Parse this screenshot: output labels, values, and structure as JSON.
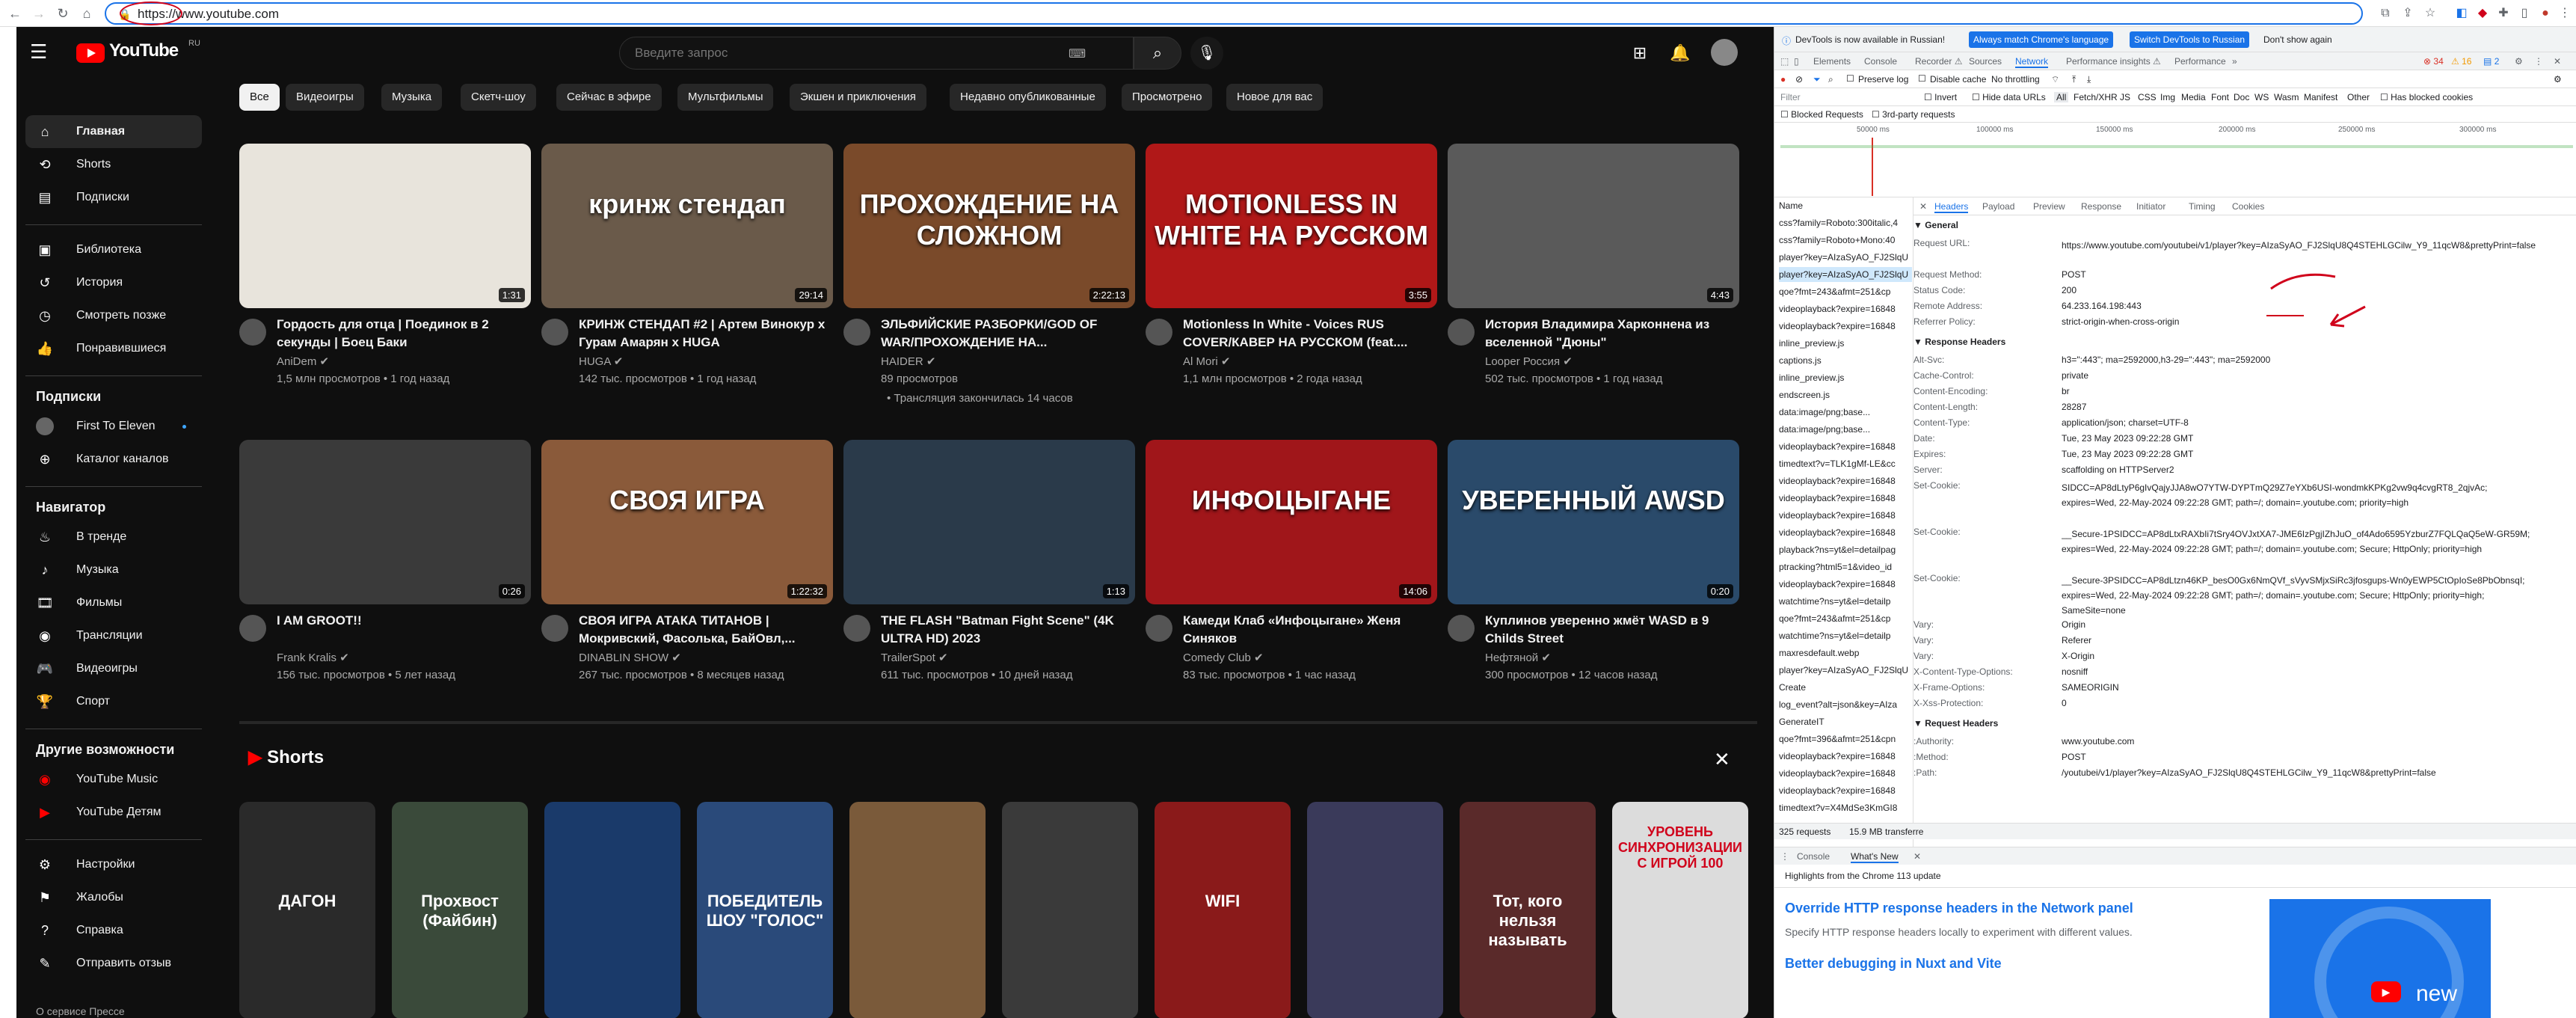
{
  "browser": {
    "url": "https://www.youtube.com",
    "icons": [
      "back-icon",
      "forward-icon",
      "reload-icon",
      "home-icon"
    ]
  },
  "youtube": {
    "logo_text": "YouTube",
    "country_code": "RU",
    "search_placeholder": "Введите запрос",
    "sidebar": {
      "main": [
        {
          "label": "Главная",
          "icon": "home-icon"
        },
        {
          "label": "Shorts",
          "icon": "shorts-icon"
        },
        {
          "label": "Подписки",
          "icon": "subscriptions-icon"
        }
      ],
      "library": [
        {
          "label": "Библиотека",
          "icon": "library-icon"
        },
        {
          "label": "История",
          "icon": "history-icon"
        },
        {
          "label": "Смотреть позже",
          "icon": "clock-icon"
        },
        {
          "label": "Понравившиеся",
          "icon": "like-icon"
        }
      ],
      "subs_title": "Подписки",
      "subs": [
        {
          "label": "First To Eleven"
        },
        {
          "label": "Каталог каналов"
        }
      ],
      "nav_title": "Навигатор",
      "nav": [
        {
          "label": "В тренде"
        },
        {
          "label": "Музыка"
        },
        {
          "label": "Фильмы"
        },
        {
          "label": "Трансляции"
        },
        {
          "label": "Видеоигры"
        },
        {
          "label": "Спорт"
        }
      ],
      "more_title": "Другие возможности",
      "more": [
        {
          "label": "YouTube Music"
        },
        {
          "label": "YouTube Детям"
        }
      ],
      "footer": [
        {
          "label": "Настройки"
        },
        {
          "label": "Жалобы"
        },
        {
          "label": "Справка"
        },
        {
          "label": "Отправить отзыв"
        }
      ],
      "bottom_text": "О сервисе  Прессе"
    },
    "chips": [
      "Все",
      "Видеоигры",
      "Музыка",
      "Скетч-шоу",
      "Сейчас в эфире",
      "Мультфильмы",
      "Экшен и приключения",
      "Недавно опубликованные",
      "Просмотрено",
      "Новое для вас"
    ],
    "videos": [
      {
        "title": "Гордость для отца | Поединок в 2 секунды | Боец Баки",
        "channel": "AniDem",
        "meta": "1,5 млн просмотров • 1 год назад",
        "duration": "1:31",
        "thumb_text": "",
        "color": "#e8e4dc"
      },
      {
        "title": "КРИНЖ СТЕНДАП #2 | Артем Винокур x Гурам Амарян x HUGA",
        "channel": "HUGA",
        "meta": "142 тыс. просмотров • 1 год назад",
        "duration": "29:14",
        "thumb_text": "кринж стендап",
        "color": "#6a5a4a"
      },
      {
        "title": "ЭЛЬФИЙСКИЕ РАЗБОРКИ/GOD OF WAR/ПРОХОЖДЕНИЕ НА...",
        "channel": "HAIDER",
        "meta": "89 просмотров",
        "extra": "• Трансляция закончилась 14 часов",
        "duration": "2:22:13",
        "thumb_text": "ПРОХОЖДЕНИЕ НА СЛОЖНОМ",
        "color": "#7a4a2a"
      },
      {
        "title": "Motionless In White - Voices RUS COVER/КАВЕР НА РУССКОМ (feat....",
        "channel": "Al Mori",
        "meta": "1,1 млн просмотров • 2 года назад",
        "duration": "3:55",
        "thumb_text": "MOTIONLESS IN WHITE НА РУССКОМ",
        "color": "#b01818"
      },
      {
        "title": "История Владимира Харконнена из вселенной \"Дюны\"",
        "channel": "Looper Россия",
        "meta": "502 тыс. просмотров • 1 год назад",
        "duration": "4:43",
        "thumb_text": "",
        "color": "#5a5a5a"
      },
      {
        "title": "I AM GROOT!!",
        "channel": "Frank Kralis",
        "meta": "156 тыс. просмотров • 5 лет назад",
        "duration": "0:26",
        "thumb_text": "",
        "color": "#3a3a3a"
      },
      {
        "title": "СВОЯ ИГРА АТАКА ТИТАНОВ | Мокривский, Фасолька, БайОвл,...",
        "channel": "DINABLIN SHOW",
        "meta": "267 тыс. просмотров • 8 месяцев назад",
        "duration": "1:22:32",
        "thumb_text": "СВОЯ ИГРА",
        "color": "#8a5a3a"
      },
      {
        "title": "THE FLASH \"Batman Fight Scene\" (4K ULTRA HD) 2023",
        "channel": "TrailerSpot",
        "meta": "611 тыс. просмотров • 10 дней назад",
        "duration": "1:13",
        "thumb_text": "",
        "color": "#2a3a4a"
      },
      {
        "title": "Камеди Клаб «Инфоцыгане» Женя Синяков",
        "channel": "Comedy Club",
        "meta": "83 тыс. просмотров • 1 час назад",
        "duration": "14:06",
        "thumb_text": "ИНФОЦЫГАНЕ",
        "color": "#a0161a"
      },
      {
        "title": "Куплинов уверенно жмёт WASD в 9 Childs Street",
        "channel": "Нефтяной",
        "meta": "300 просмотров • 12 часов назад",
        "duration": "0:20",
        "thumb_text": "УВЕРЕННЫЙ AWSD",
        "color": "#2a4a6a"
      }
    ],
    "shorts_title": "Shorts",
    "shorts": [
      {
        "text": "ДАГОН",
        "color": "#2a2a2a"
      },
      {
        "text": "Прохвост (Файбин)",
        "color": "#3a4a3a"
      },
      {
        "text": "",
        "color": "#1a3a6a"
      },
      {
        "text": "ПОБЕДИТЕЛЬ ШОУ \"ГОЛОС\"",
        "color": "#2a4a7a"
      },
      {
        "text": "",
        "color": "#7a5a3a"
      },
      {
        "text": "",
        "color": "#3a3a3a"
      },
      {
        "text": "WIFI",
        "color": "#8a1a1a"
      },
      {
        "text": "",
        "color": "#3a3a5a"
      },
      {
        "text": "Тот, кого нельзя называть",
        "color": "#5a2a2a"
      },
      {
        "text": "УРОВЕНЬ СИНХРОНИЗАЦИИ С ИГРОЙ 100",
        "color": "#dcdcdc"
      }
    ]
  },
  "devtools": {
    "banner": "DevTools is now available in Russian!",
    "banner_btn1": "Always match Chrome's language",
    "banner_btn2": "Switch DevTools to Russian",
    "banner_btn3": "Don't show again",
    "tabs": [
      "Elements",
      "Console",
      "Recorder ⚠",
      "Sources",
      "Network",
      "Performance insights ⚠",
      "Performance"
    ],
    "active_tab": "Network",
    "badges": {
      "errors": "34",
      "warnings": "16",
      "info": "2"
    },
    "toolbar": {
      "preserve_log": "Preserve log",
      "disable_cache": "Disable cache",
      "throttling": "No throttling"
    },
    "filter_label": "Filter",
    "filter_opts": [
      "Invert",
      "Hide data URLs",
      "All",
      "Fetch/XHR",
      "JS",
      "CSS",
      "Img",
      "Media",
      "Font",
      "Doc",
      "WS",
      "Wasm",
      "Manifest",
      "Other",
      "Has blocked cookies"
    ],
    "blocked_requests": "Blocked Requests",
    "third_party": "3rd-party requests",
    "timeline": [
      "50000 ms",
      "100000 ms",
      "150000 ms",
      "200000 ms",
      "250000 ms",
      "300000 ms"
    ],
    "name_header": "Name",
    "requests": [
      "css?family=Roboto:300italic,4",
      "css?family=Roboto+Mono:40",
      "player?key=AIzaSyAO_FJ2SlqU",
      "player?key=AIzaSyAO_FJ2SlqU",
      "qoe?fmt=243&afmt=251&cp",
      "videoplayback?expire=16848",
      "videoplayback?expire=16848",
      "inline_preview.js",
      "captions.js",
      "inline_preview.js",
      "endscreen.js",
      "data:image/png;base...",
      "data:image/png;base...",
      "videoplayback?expire=16848",
      "timedtext?v=TLK1gMf-LE&cc",
      "videoplayback?expire=16848",
      "videoplayback?expire=16848",
      "videoplayback?expire=16848",
      "videoplayback?expire=16848",
      "playback?ns=yt&el=detailpag",
      "ptracking?html5=1&video_id",
      "videoplayback?expire=16848",
      "watchtime?ns=yt&el=detailp",
      "qoe?fmt=243&afmt=251&cp",
      "watchtime?ns=yt&el=detailp",
      "maxresdefault.webp",
      "player?key=AIzaSyAO_FJ2SlqU",
      "Create",
      "log_event?alt=json&key=AIza",
      "GenerateIT",
      "qoe?fmt=396&afmt=251&cpn",
      "videoplayback?expire=16848",
      "videoplayback?expire=16848",
      "videoplayback?expire=16848",
      "timedtext?v=X4MdSe3KmGI8"
    ],
    "footer_requests": "325 requests",
    "footer_transferred": "15.9 MB transferre",
    "detail_tabs": [
      "Headers",
      "Payload",
      "Preview",
      "Response",
      "Initiator",
      "Timing",
      "Cookies"
    ],
    "general_title": "▼ General",
    "general": [
      {
        "k": "Request URL:",
        "v": "https://www.youtube.com/youtubei/v1/player?key=AIzaSyAO_FJ2SlqU8Q4STEHLGCilw_Y9_11qcW8&prettyPrint=false"
      },
      {
        "k": "Request Method:",
        "v": "POST"
      },
      {
        "k": "Status Code:",
        "v": "200"
      },
      {
        "k": "Remote Address:",
        "v": "64.233.164.198:443"
      },
      {
        "k": "Referrer Policy:",
        "v": "strict-origin-when-cross-origin"
      }
    ],
    "response_title": "▼ Response Headers",
    "response": [
      {
        "k": "Alt-Svc:",
        "v": "h3=\":443\"; ma=2592000,h3-29=\":443\"; ma=2592000"
      },
      {
        "k": "Cache-Control:",
        "v": "private"
      },
      {
        "k": "Content-Encoding:",
        "v": "br"
      },
      {
        "k": "Content-Length:",
        "v": "28287"
      },
      {
        "k": "Content-Type:",
        "v": "application/json; charset=UTF-8"
      },
      {
        "k": "Date:",
        "v": "Tue, 23 May 2023 09:22:28 GMT"
      },
      {
        "k": "Expires:",
        "v": "Tue, 23 May 2023 09:22:28 GMT"
      },
      {
        "k": "Server:",
        "v": "scaffolding on HTTPServer2"
      },
      {
        "k": "Set-Cookie:",
        "v": "SIDCC=AP8dLtyP6gIvQajyJJA8wO7YTW-DYPTmQ29Z7eYXb6USI-wondmkKPKg2vw9q4cvgRT8_2qjvAc; expires=Wed, 22-May-2024 09:22:28 GMT; path=/; domain=.youtube.com; priority=high"
      },
      {
        "k": "Set-Cookie:",
        "v": "__Secure-1PSIDCC=AP8dLtxRAXbIi7tSry4OVJxtXA7-JME6IzPgjIZhJuO_of4Ado6595YzburZ7FQLQaQ5eW-GR59M; expires=Wed, 22-May-2024 09:22:28 GMT; path=/; domain=.youtube.com; Secure; HttpOnly; priority=high"
      },
      {
        "k": "Set-Cookie:",
        "v": "__Secure-3PSIDCC=AP8dLtzn46KP_besO0Gx6NmQVf_sVyvSMjxSiRc3jfosgups-Wn0yEWP5CtOpIoSe8PbObnsqI; expires=Wed, 22-May-2024 09:22:28 GMT; path=/; domain=.youtube.com; Secure; HttpOnly; priority=high; SameSite=none"
      },
      {
        "k": "Vary:",
        "v": "Origin"
      },
      {
        "k": "Vary:",
        "v": "Referer"
      },
      {
        "k": "Vary:",
        "v": "X-Origin"
      },
      {
        "k": "X-Content-Type-Options:",
        "v": "nosniff"
      },
      {
        "k": "X-Frame-Options:",
        "v": "SAMEORIGIN"
      },
      {
        "k": "X-Xss-Protection:",
        "v": "0"
      }
    ],
    "request_title": "▼ Request Headers",
    "request": [
      {
        "k": ":Authority:",
        "v": "www.youtube.com"
      },
      {
        "k": ":Method:",
        "v": "POST"
      },
      {
        "k": ":Path:",
        "v": "/youtubei/v1/player?key=AIzaSyAO_FJ2SlqU8Q4STEHLGCilw_Y9_11qcW8&prettyPrint=false"
      }
    ],
    "drawer_tabs": [
      "Console",
      "What's New"
    ],
    "whats_new_head": "Highlights from the Chrome 113 update",
    "whats_new_1": "Override HTTP response headers in the Network panel",
    "whats_new_1_desc": "Specify HTTP response headers locally to experiment with different values.",
    "whats_new_2": "Better debugging in Nuxt and Vite",
    "promo_text": "new"
  }
}
